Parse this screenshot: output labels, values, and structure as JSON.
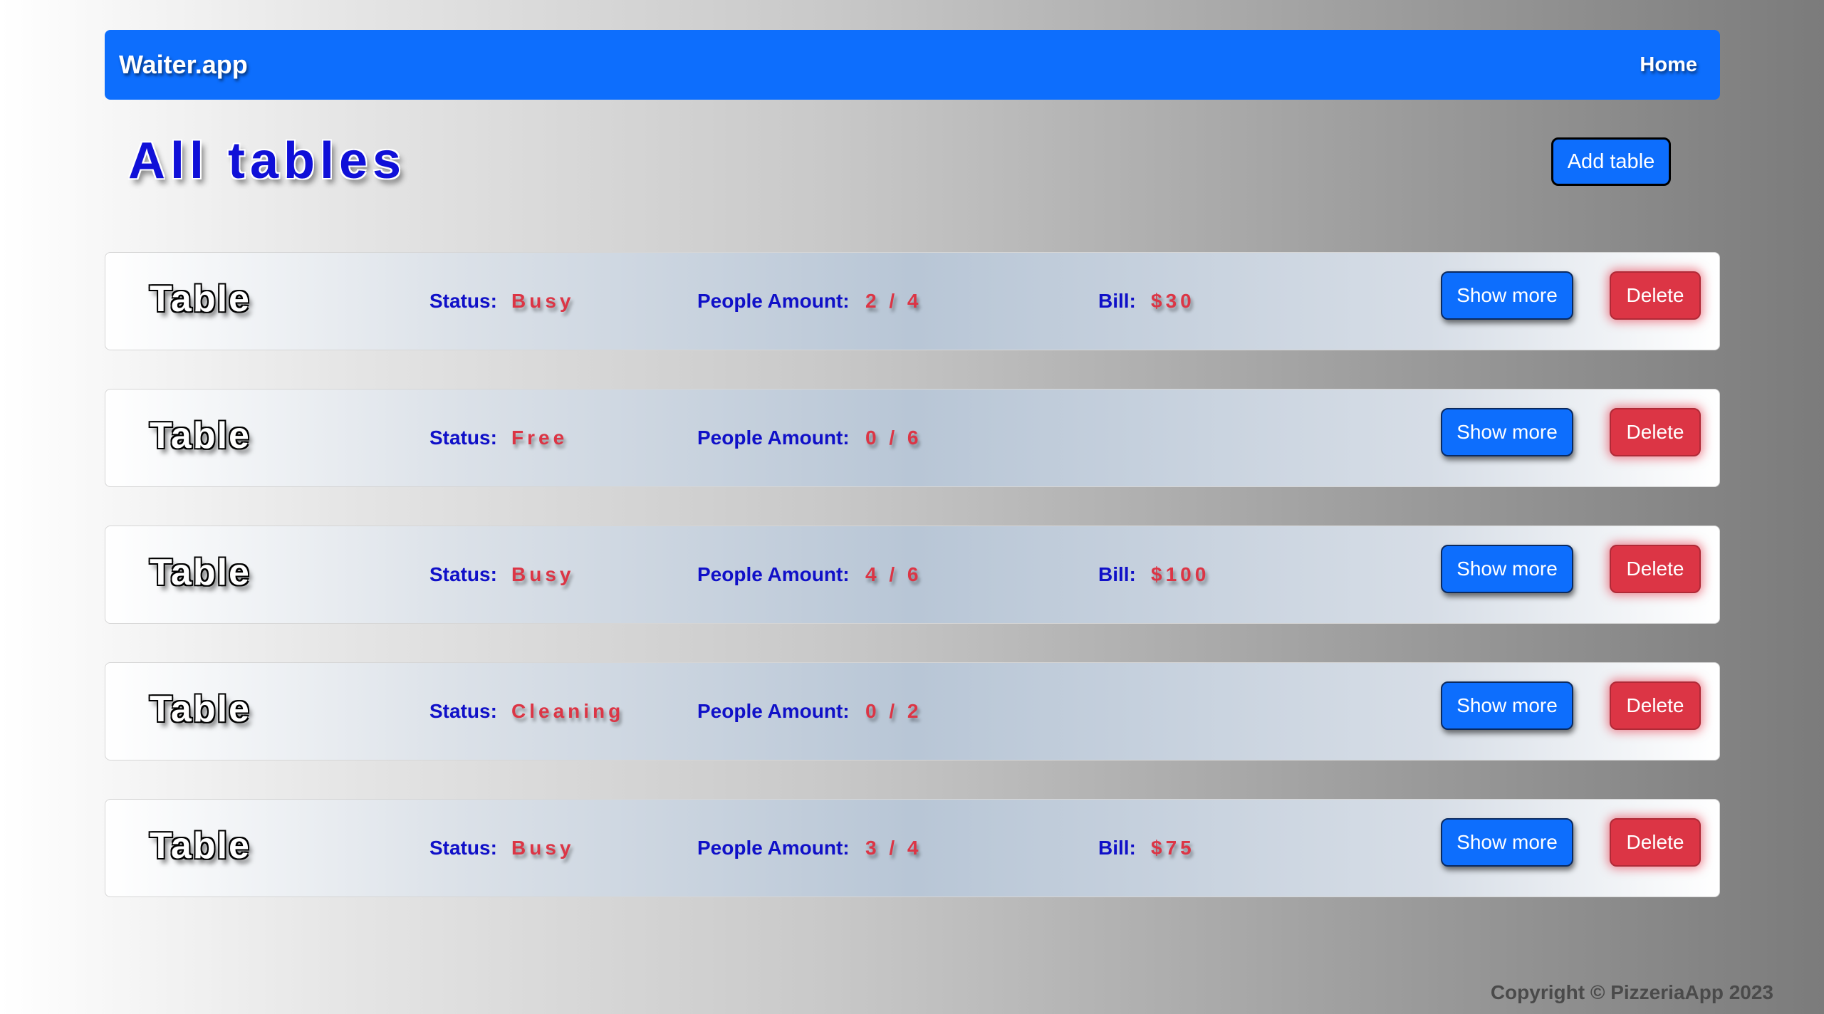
{
  "navbar": {
    "brand": "Waiter.app",
    "home_label": "Home"
  },
  "page": {
    "title": "All tables",
    "add_button_label": "Add table"
  },
  "labels": {
    "table": "Table",
    "status": "Status:",
    "people": "People Amount:",
    "bill": "Bill:",
    "show_more": "Show more",
    "delete": "Delete"
  },
  "tables": [
    {
      "status": "Busy",
      "people": "2 / 4",
      "bill": "$30"
    },
    {
      "status": "Free",
      "people": "0 / 6",
      "bill": null
    },
    {
      "status": "Busy",
      "people": "4 / 6",
      "bill": "$100"
    },
    {
      "status": "Cleaning",
      "people": "0 / 2",
      "bill": null
    },
    {
      "status": "Busy",
      "people": "3 / 4",
      "bill": "$75"
    }
  ],
  "footer": {
    "copyright": "Copyright © PizzeriaApp 2023"
  },
  "colors": {
    "primary": "#0d6efd",
    "danger": "#dc3545",
    "label_blue": "#1010c8"
  }
}
